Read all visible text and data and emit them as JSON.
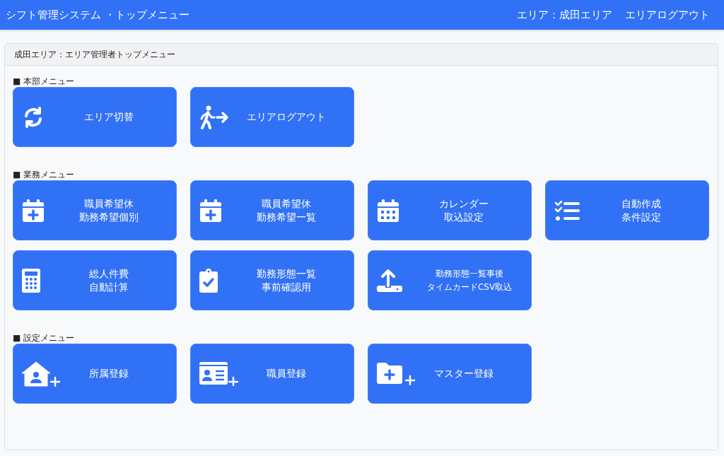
{
  "header": {
    "title": "シフト管理システム ・トップメニュー",
    "area_label": "エリア：成田エリア",
    "logout_link": "エリアログアウト"
  },
  "panel": {
    "title": "成田エリア：エリア管理者トップメニュー"
  },
  "sections": [
    {
      "label": "■ 本部メニュー",
      "buttons": [
        {
          "kind": "refresh",
          "lines": [
            "エリア切替"
          ]
        },
        {
          "kind": "walk-exit",
          "lines": [
            "エリアログアウト"
          ]
        }
      ]
    },
    {
      "label": "■ 業務メニュー",
      "buttons": [
        {
          "kind": "calendar-plus",
          "lines": [
            "職員希望休",
            "勤務希望個別"
          ]
        },
        {
          "kind": "calendar-plus",
          "lines": [
            "職員希望休",
            "勤務希望一覧"
          ]
        },
        {
          "kind": "calendar-grid",
          "lines": [
            "カレンダー",
            "取込設定"
          ]
        },
        {
          "kind": "checklist",
          "lines": [
            "自動作成",
            "条件設定"
          ]
        },
        {
          "kind": "calculator",
          "lines": [
            "総人件費",
            "自動計算"
          ]
        },
        {
          "kind": "clipboard-check",
          "lines": [
            "勤務形態一覧",
            "事前確認用"
          ]
        },
        {
          "kind": "upload",
          "lines": [
            "勤務形態一覧事後",
            "タイムカードCSV取込"
          ]
        }
      ]
    },
    {
      "label": "■ 設定メニュー",
      "buttons": [
        {
          "kind": "house-plus",
          "lines": [
            "所属登録"
          ]
        },
        {
          "kind": "card-plus",
          "lines": [
            "職員登録"
          ]
        },
        {
          "kind": "folder-plus",
          "lines": [
            "マスター登録"
          ]
        }
      ]
    }
  ]
}
